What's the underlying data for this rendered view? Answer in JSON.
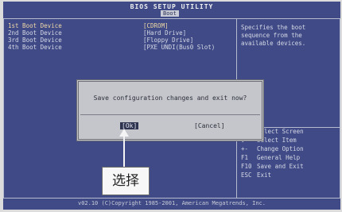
{
  "header": {
    "title": "BIOS SETUP UTILITY",
    "menu": "Boot"
  },
  "boot_order": [
    {
      "label": "1st Boot Device",
      "value": "[CDROM]"
    },
    {
      "label": "2nd Boot Device",
      "value": "[Hard Drive]"
    },
    {
      "label": "3rd Boot Device",
      "value": "[Floppy Drive]"
    },
    {
      "label": "4th Boot Device",
      "value": "[PXE UNDI(Bus0 Slot)"
    }
  ],
  "help": {
    "text": "Specifies the boot sequence from the available devices."
  },
  "keys": [
    {
      "key": "",
      "desc": "Select Screen"
    },
    {
      "key": "",
      "desc": "Select Item"
    },
    {
      "key": "+-",
      "desc": "Change Option"
    },
    {
      "key": "F1",
      "desc": "General Help"
    },
    {
      "key": "F10",
      "desc": "Save and Exit"
    },
    {
      "key": "ESC",
      "desc": "Exit"
    }
  ],
  "dialog": {
    "message": "Save configuration changes and exit now?",
    "ok_label": "[Ok]",
    "cancel_label": "[Cancel]"
  },
  "footer": {
    "text": "v02.10 (C)Copyright 1985-2001, American Megatrends, Inc."
  },
  "annotation": {
    "label": "选择"
  }
}
